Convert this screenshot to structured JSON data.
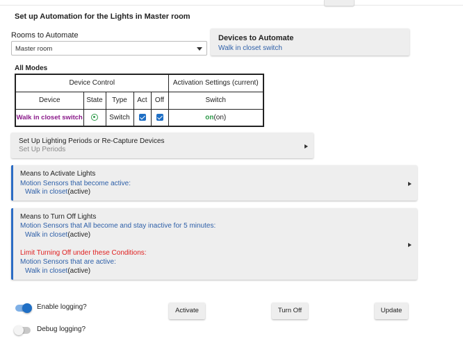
{
  "page": {
    "title": "Set up Automation for the Lights in Master room"
  },
  "rooms": {
    "label": "Rooms to Automate",
    "selected": "Master room"
  },
  "devices": {
    "header": "Devices to Automate",
    "value": "Walk in closet switch"
  },
  "modes": {
    "label": "All Modes",
    "group_device_control": "Device Control",
    "group_activation": "Activation Settings (current)",
    "columns": [
      "Device",
      "State",
      "Type",
      "Act",
      "Off",
      "Switch"
    ],
    "row": {
      "device": "Walk in closet switch",
      "type": "Switch",
      "switch_on": "on",
      "switch_paren": "(on)"
    }
  },
  "periods": {
    "title": "Set Up Lighting Periods or Re-Capture Devices",
    "sub": "Set Up Periods"
  },
  "activate_card": {
    "title": "Means to Activate Lights",
    "line1": "Motion Sensors that become active:",
    "sensor": "Walk in closet",
    "state": "(active)"
  },
  "turnoff_card": {
    "title": "Means to Turn Off Lights",
    "line1": "Motion Sensors that All become and stay inactive for 5 minutes:",
    "sensor1": "Walk in closet",
    "state1": "(active)",
    "limit": "Limit Turning Off under these Conditions:",
    "line2": "Motion Sensors that are active:",
    "sensor2": "Walk in closet",
    "state2": "(active)"
  },
  "logging": {
    "enable": "Enable logging?",
    "debug": "Debug logging?"
  },
  "buttons": {
    "activate": "Activate",
    "turn_off": "Turn Off",
    "update": "Update"
  },
  "colors": {
    "accent": "#2b6cc4",
    "link": "#2d5fa8",
    "warn": "#e02020",
    "ok": "#2e9a4a",
    "device": "#8a1a8a"
  }
}
